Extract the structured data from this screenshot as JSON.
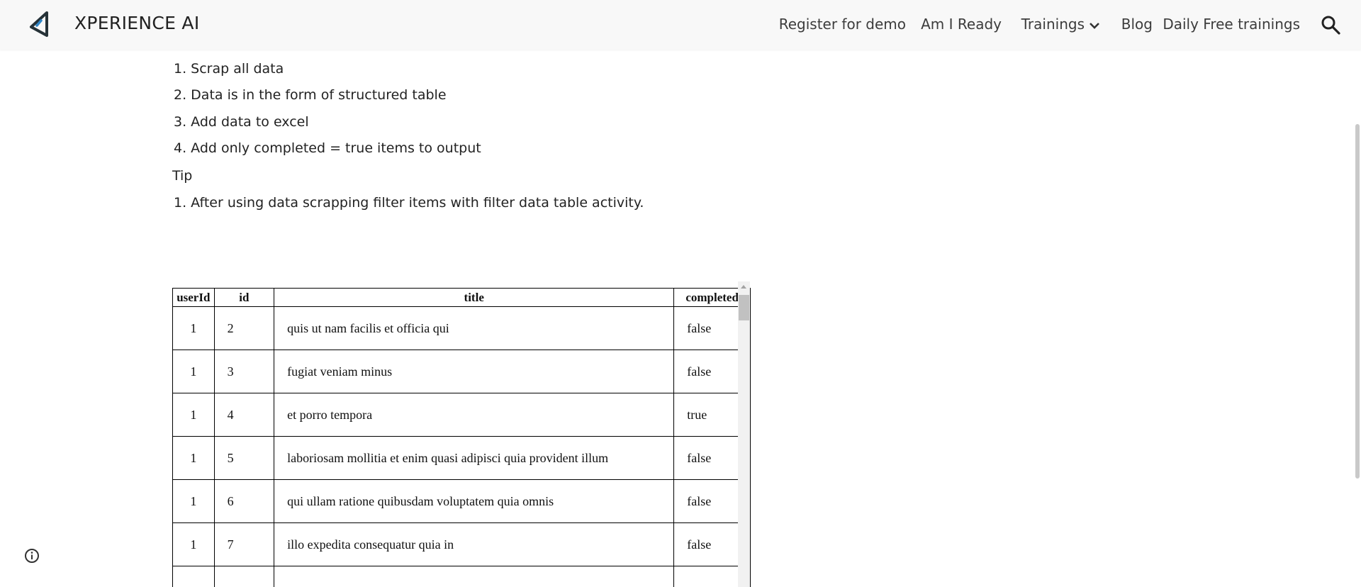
{
  "header": {
    "site_title": "XPERIENCE AI",
    "nav": [
      {
        "label": "Register for demo"
      },
      {
        "label": "Am I Ready"
      },
      {
        "label": "Trainings"
      },
      {
        "label": "Blog"
      },
      {
        "label": "Daily Free trainings"
      }
    ],
    "search_icon": "search-icon",
    "logo_icon": "xperience-logo-icon"
  },
  "content": {
    "steps": [
      "1. Scrap all data",
      "2. Data is in the form of structured table",
      "3. Add data to excel",
      "4. Add only completed = true items to output"
    ],
    "tip_label": "Tip",
    "tips": [
      "1. After using data scrapping filter items with filter data table activity."
    ]
  },
  "table": {
    "columns": [
      "userId",
      "id",
      "title",
      "completed"
    ],
    "rows": [
      [
        "1",
        "2",
        "quis ut nam facilis et officia qui",
        "false"
      ],
      [
        "1",
        "3",
        "fugiat veniam minus",
        "false"
      ],
      [
        "1",
        "4",
        "et porro tempora",
        "true"
      ],
      [
        "1",
        "5",
        "laboriosam mollitia et enim quasi adipisci quia provident illum",
        "false"
      ],
      [
        "1",
        "6",
        "qui ullam ratione quibusdam voluptatem quia omnis",
        "false"
      ],
      [
        "1",
        "7",
        "illo expedita consequatur quia in",
        "false"
      ]
    ]
  },
  "footer": {
    "info_icon": "info-icon"
  },
  "colors": {
    "header_bg": "#f8f8f8",
    "text": "#212121",
    "table_border": "#000000",
    "scrollbar_track": "#f1f1f1",
    "scrollbar_thumb": "#c1c1c1"
  }
}
